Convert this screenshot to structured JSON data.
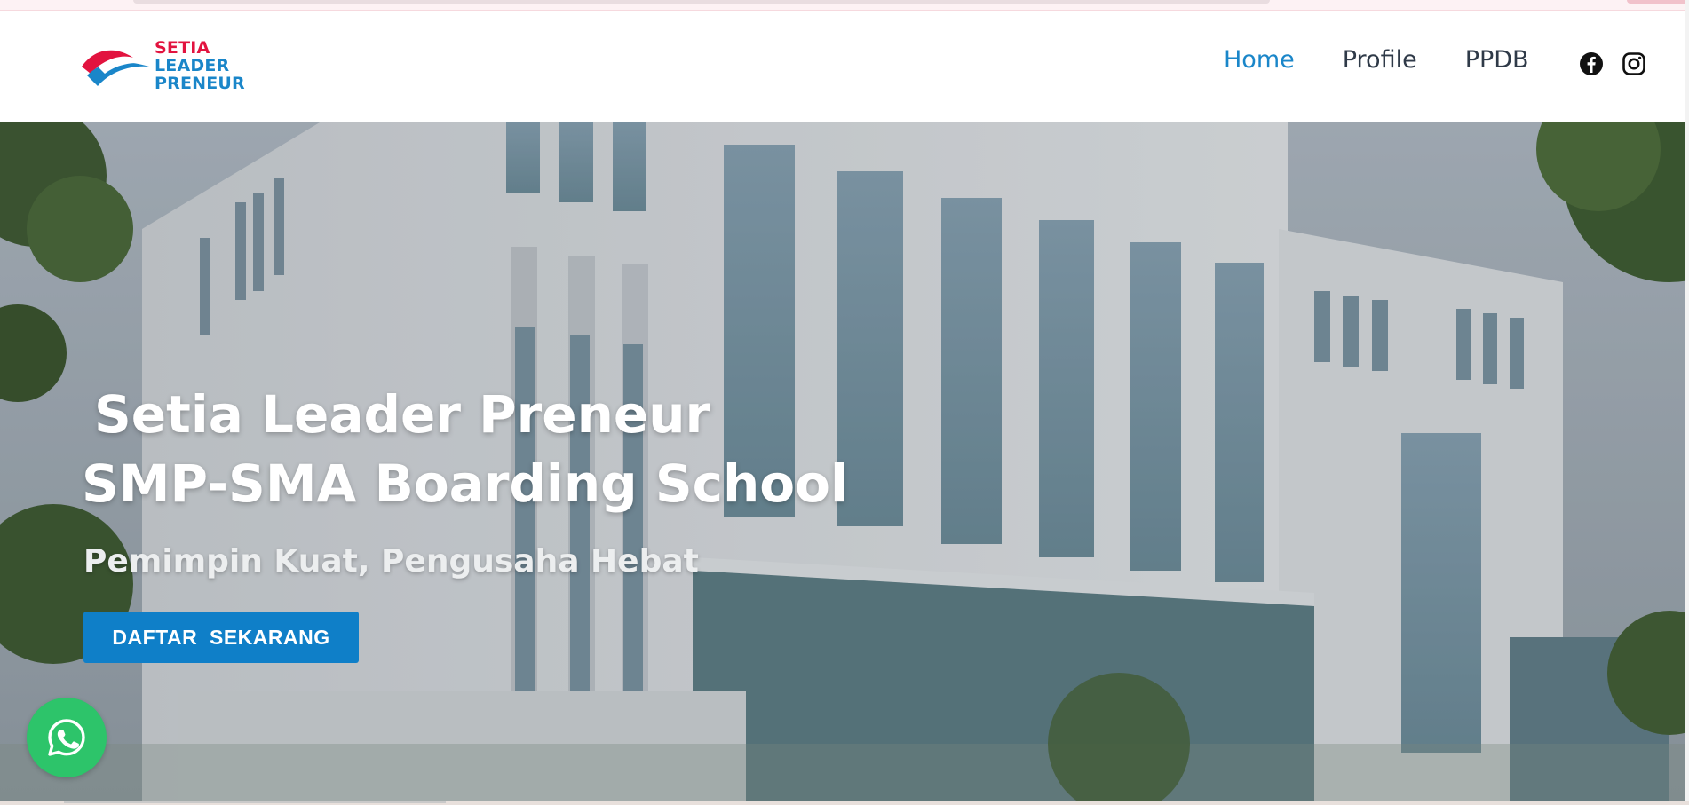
{
  "brand": {
    "logo_lines": [
      "SETIA",
      "LEADER",
      "PRENEUR"
    ]
  },
  "nav": {
    "items": [
      {
        "label": "Home",
        "active": true
      },
      {
        "label": "Profile",
        "active": false
      },
      {
        "label": "PPDB",
        "active": false
      }
    ]
  },
  "social": {
    "icons": [
      "facebook-icon",
      "instagram-icon"
    ]
  },
  "hero": {
    "title_line1": "Setia Leader Preneur",
    "title_line2": "SMP-SMA Boarding School",
    "subtitle": "Pemimpin Kuat, Pengusaha Hebat",
    "cta_label": "DAFTAR  SEKARANG"
  },
  "whatsapp": {
    "icon": "whatsapp-icon"
  },
  "colors": {
    "accent": "#1a86c9",
    "brand_red": "#e2133f",
    "cta": "#0f7fc8",
    "whatsapp": "#2dc46a"
  }
}
